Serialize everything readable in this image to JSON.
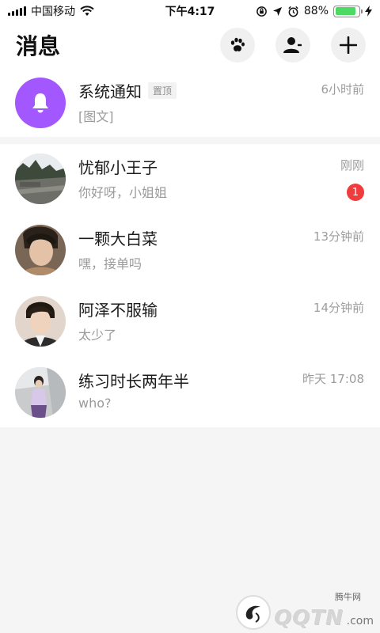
{
  "status_bar": {
    "carrier": "中国移动",
    "time": "下午4:17",
    "battery": "88%",
    "battery_level": 0.88,
    "battery_color": "#4cd964"
  },
  "header": {
    "title": "消息",
    "actions": [
      "paw-icon",
      "person-icon",
      "plus-icon"
    ]
  },
  "pinned": {
    "name": "系统通知",
    "tag": "置顶",
    "preview": "[图文]",
    "time": "6小时前",
    "icon": "bell-icon",
    "avatar_color": "#a257ff"
  },
  "chats": [
    {
      "name": "忧郁小王子",
      "preview": "你好呀，小姐姐",
      "time": "刚刚",
      "badge": "1"
    },
    {
      "name": "一颗大白菜",
      "preview": "嘿，接单吗",
      "time": "13分钟前"
    },
    {
      "name": "阿泽不服输",
      "preview": "太少了",
      "time": "14分钟前"
    },
    {
      "name": "练习时长两年半",
      "preview": "who?",
      "time": "昨天 17:08"
    }
  ],
  "watermark": {
    "chinese": "腾牛网",
    "latin": "QQTN",
    "suffix": ".com"
  },
  "colors": {
    "badge": "#f03c3c",
    "background": "#f5f5f5"
  }
}
